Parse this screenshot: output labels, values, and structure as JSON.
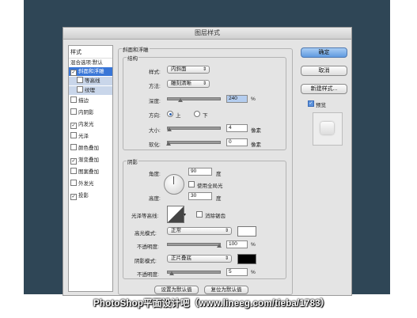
{
  "dialog": {
    "title": "图层样式"
  },
  "sidebar": {
    "header": "样式",
    "items": [
      {
        "label": "混合选项:默认",
        "checkbox": false,
        "checked": false
      },
      {
        "label": "斜面和浮雕",
        "checkbox": true,
        "checked": true
      },
      {
        "label": "等高线",
        "checkbox": true,
        "checked": false
      },
      {
        "label": "纹理",
        "checkbox": true,
        "checked": false
      },
      {
        "label": "描边",
        "checkbox": true,
        "checked": false
      },
      {
        "label": "内阴影",
        "checkbox": true,
        "checked": false
      },
      {
        "label": "内发光",
        "checkbox": true,
        "checked": true
      },
      {
        "label": "光泽",
        "checkbox": true,
        "checked": false
      },
      {
        "label": "颜色叠加",
        "checkbox": true,
        "checked": false
      },
      {
        "label": "渐变叠加",
        "checkbox": true,
        "checked": true
      },
      {
        "label": "图案叠加",
        "checkbox": true,
        "checked": false
      },
      {
        "label": "外发光",
        "checkbox": true,
        "checked": false
      },
      {
        "label": "投影",
        "checkbox": true,
        "checked": true
      }
    ]
  },
  "bevel": {
    "section_title": "斜面和浮雕",
    "structure_title": "结构",
    "style_label": "样式:",
    "style_value": "内斜面",
    "technique_label": "方法:",
    "technique_value": "雕刻清晰",
    "depth_label": "深度:",
    "depth_value": "240",
    "depth_unit": "%",
    "direction_label": "方向:",
    "direction_up": "上",
    "direction_down": "下",
    "size_label": "大小:",
    "size_value": "4",
    "size_unit": "像素",
    "soften_label": "软化:",
    "soften_value": "0",
    "soften_unit": "像素"
  },
  "shading": {
    "title": "阴影",
    "angle_label": "角度:",
    "angle_value": "90",
    "angle_unit": "度",
    "global_light_label": "使用全局光",
    "altitude_label": "高度:",
    "altitude_value": "30",
    "altitude_unit": "度",
    "gloss_label": "光泽等高线:",
    "anti_alias_label": "消除锯齿",
    "highlight_mode_label": "高光模式:",
    "highlight_mode_value": "正常",
    "highlight_opacity_label": "不透明度:",
    "highlight_opacity_value": "100",
    "highlight_color": "#ffffff",
    "shadow_mode_label": "阴影模式:",
    "shadow_mode_value": "正片叠底",
    "shadow_opacity_label": "不透明度:",
    "shadow_opacity_value": "5",
    "shadow_color": "#000000",
    "percent": "%"
  },
  "footer": {
    "make_default": "设置为默认值",
    "reset_default": "复位为默认值"
  },
  "buttons": {
    "ok": "确定",
    "cancel": "取消",
    "new_style": "新建样式...",
    "preview": "预览"
  },
  "watermark": "PhotoShop平面设计吧（www.lineeg.com/tieba/1783）"
}
